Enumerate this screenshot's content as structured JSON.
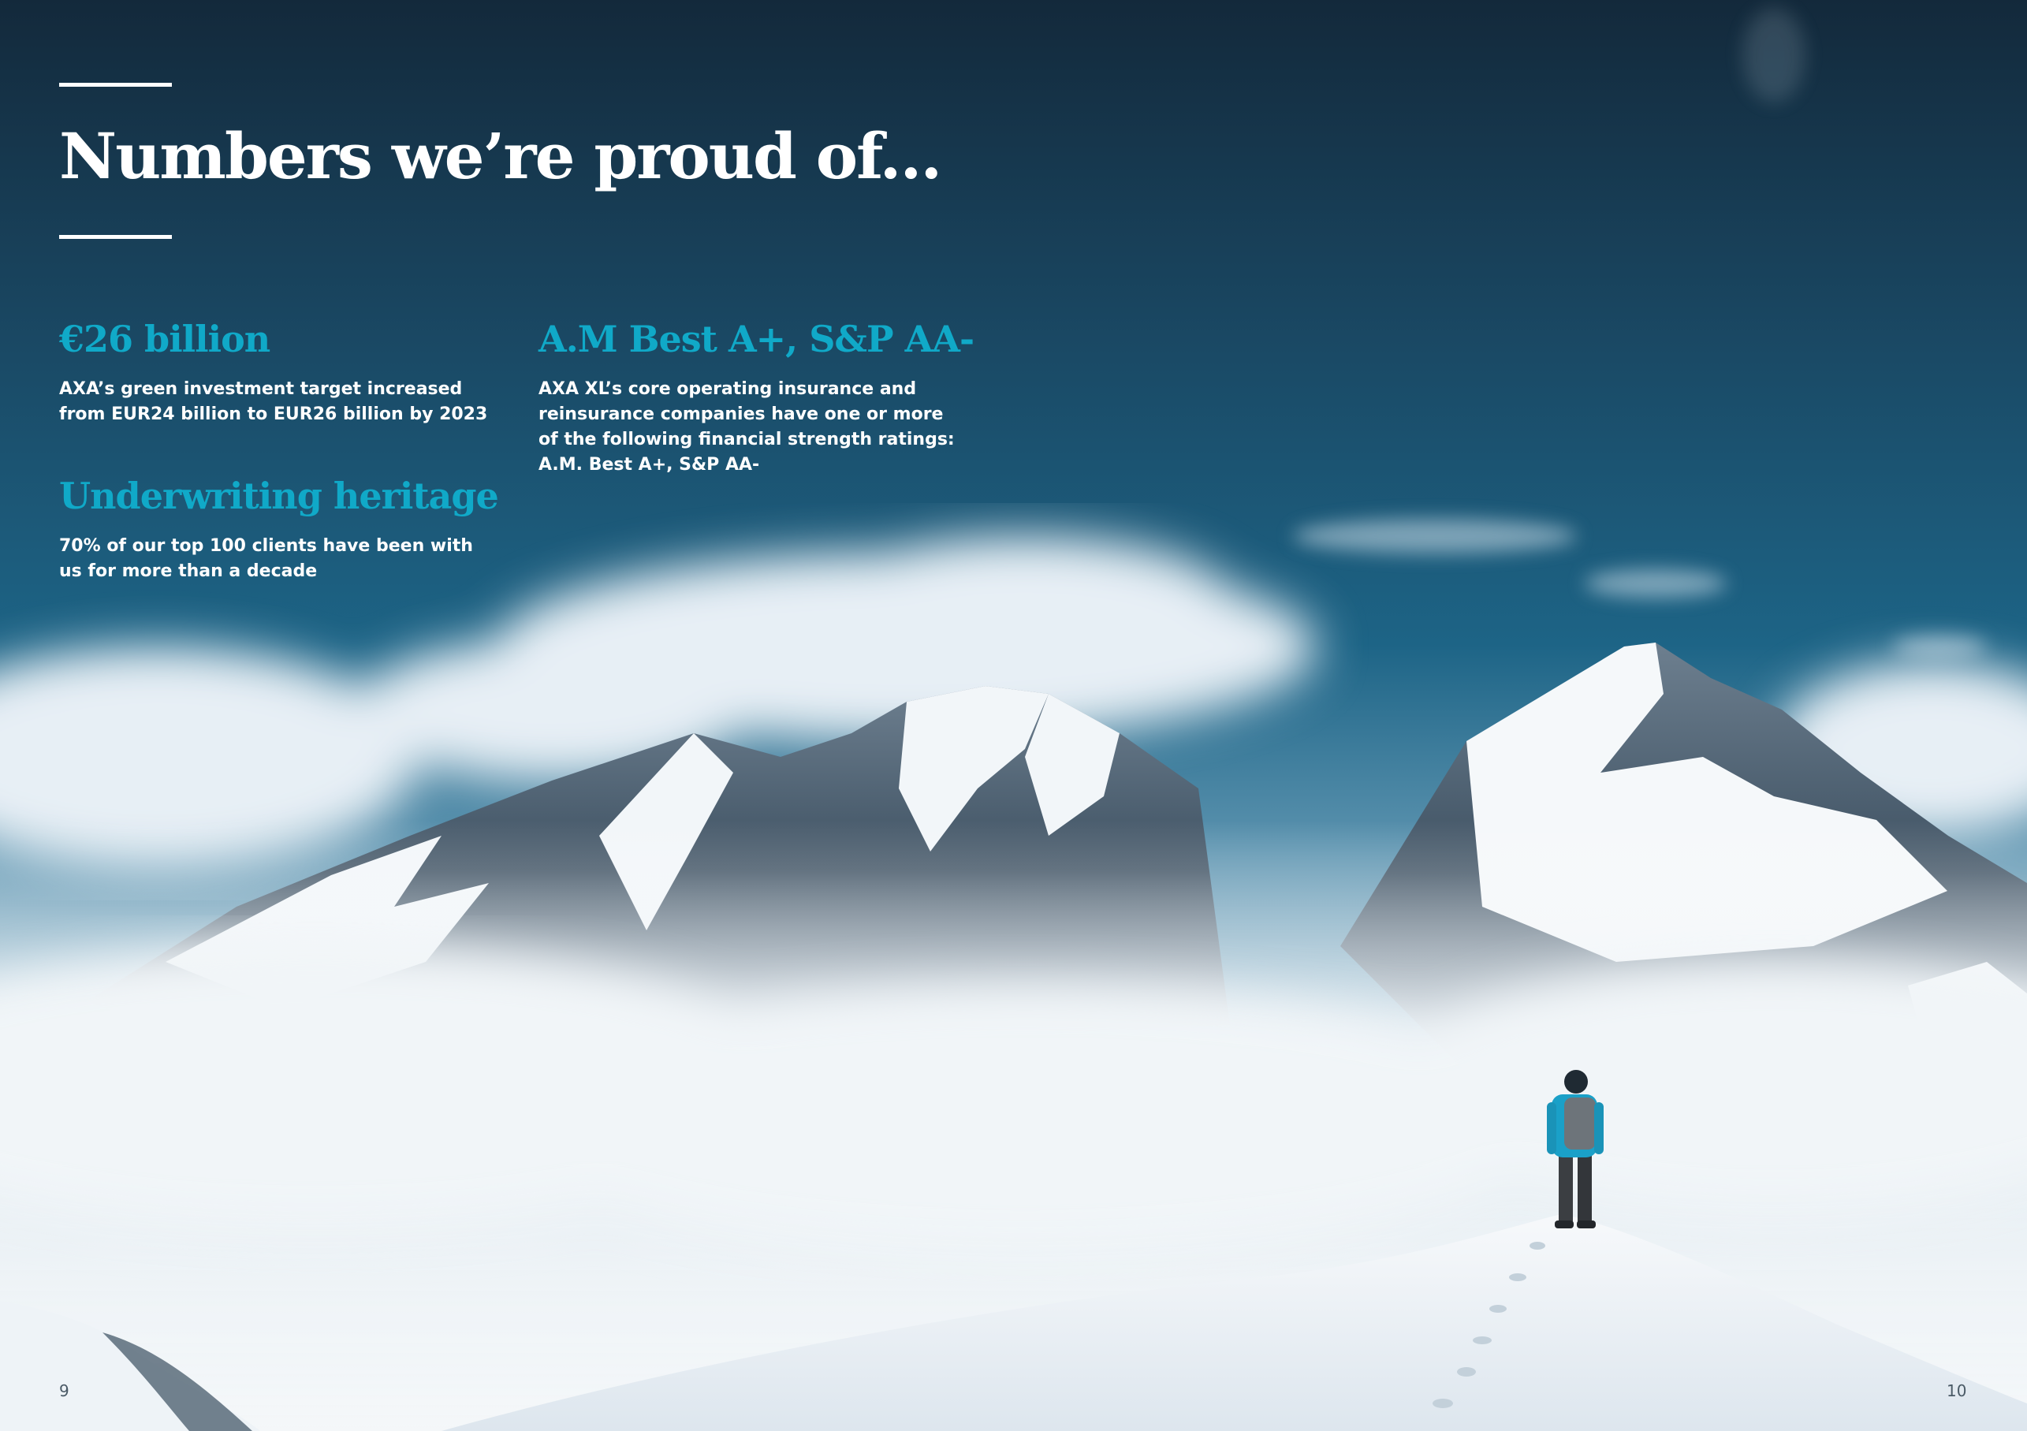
{
  "headline": {
    "title": "Numbers we’re proud of..."
  },
  "stats": [
    {
      "heading": "€26 billion",
      "body": "AXA’s green investment target increased\nfrom EUR24 billion to EUR26 billion by 2023"
    },
    {
      "heading": "A.M Best A+, S&P AA-",
      "body": "AXA XL’s core operating insurance and\nreinsurance companies have one or more\nof the following financial strength ratings:\nA.M. Best A+, S&P AA-"
    },
    {
      "heading": "Underwriting heritage",
      "body": "70% of our top 100 clients have been with\nus for more than a decade"
    }
  ],
  "footer": {
    "page_left": "9",
    "page_right": "10"
  },
  "colors": {
    "accent": "#10a9c8",
    "sky_top": "#13293b",
    "sky_mid": "#1b5a7c",
    "text": "#ffffff"
  }
}
